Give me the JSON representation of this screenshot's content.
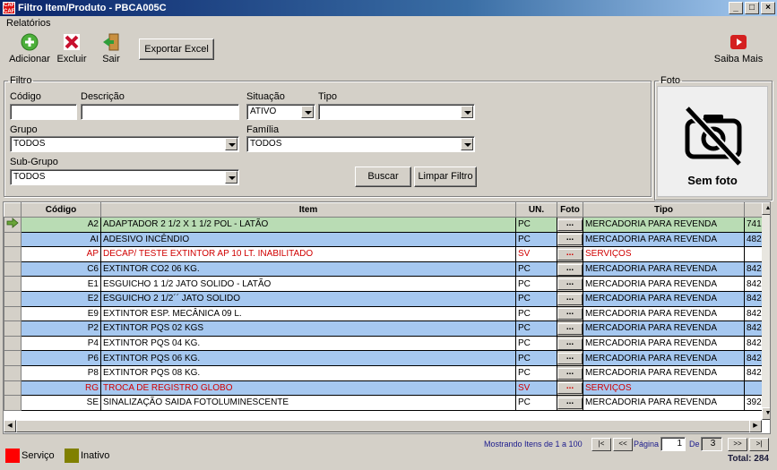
{
  "window": {
    "title": "Filtro Item/Produto - PBCA005C",
    "icon_text": "CAF CAF"
  },
  "menu": {
    "relatorios": "Relatórios"
  },
  "toolbar": {
    "adicionar": "Adicionar",
    "excluir": "Excluir",
    "sair": "Sair",
    "exportar_excel": "Exportar Excel",
    "saiba_mais": "Saiba Mais"
  },
  "filtro": {
    "legend": "Filtro",
    "codigo_label": "Código",
    "codigo_value": "",
    "descricao_label": "Descrição",
    "descricao_value": "",
    "situacao_label": "Situação",
    "situacao_value": "ATIVO",
    "tipo_label": "Tipo",
    "tipo_value": "",
    "grupo_label": "Grupo",
    "grupo_value": "TODOS",
    "familia_label": "Família",
    "familia_value": "TODOS",
    "subgrupo_label": "Sub-Grupo",
    "subgrupo_value": "TODOS",
    "buscar": "Buscar",
    "limpar_filtro": "Limpar Filtro"
  },
  "foto": {
    "legend": "Foto",
    "caption": "Sem foto"
  },
  "grid": {
    "columns": [
      "Código",
      "Item",
      "UN.",
      "Foto",
      "Tipo"
    ],
    "rows": [
      {
        "codigo": "A2",
        "item": "ADAPTADOR 2 1/2 X 1 1/2 POL - LATÃO",
        "un": "PC",
        "foto": "...",
        "tipo": "MERCADORIA PARA REVENDA",
        "extra": "741"
      },
      {
        "codigo": "AI",
        "item": "ADESIVO INCÊNDIO",
        "un": "PC",
        "foto": "...",
        "tipo": "MERCADORIA PARA REVENDA",
        "extra": "482"
      },
      {
        "codigo": "AP",
        "item": "DECAP/ TESTE EXTINTOR AP 10 LT. INABILITADO",
        "un": "SV",
        "foto": "...",
        "tipo": "SERVIÇOS",
        "extra": ""
      },
      {
        "codigo": "C6",
        "item": "EXTINTOR CO2 06 KG.",
        "un": "PC",
        "foto": "...",
        "tipo": "MERCADORIA PARA REVENDA",
        "extra": "842"
      },
      {
        "codigo": "E1",
        "item": "ESGUICHO 1 1/2 JATO SOLIDO - LATÃO",
        "un": "PC",
        "foto": "...",
        "tipo": "MERCADORIA PARA REVENDA",
        "extra": "842"
      },
      {
        "codigo": "E2",
        "item": "ESGUICHO 2 1/2´´ JATO SOLIDO",
        "un": "PC",
        "foto": "...",
        "tipo": "MERCADORIA PARA REVENDA",
        "extra": "842"
      },
      {
        "codigo": "E9",
        "item": "EXTINTOR ESP. MECÂNICA 09 L.",
        "un": "PC",
        "foto": "...",
        "tipo": "MERCADORIA PARA REVENDA",
        "extra": "842"
      },
      {
        "codigo": "P2",
        "item": "EXTINTOR PQS 02 KGS",
        "un": "PC",
        "foto": "...",
        "tipo": "MERCADORIA PARA REVENDA",
        "extra": "842"
      },
      {
        "codigo": "P4",
        "item": "EXTINTOR PQS 04 KG.",
        "un": "PC",
        "foto": "...",
        "tipo": "MERCADORIA PARA REVENDA",
        "extra": "842"
      },
      {
        "codigo": "P6",
        "item": "EXTINTOR PQS 06 KG.",
        "un": "PC",
        "foto": "...",
        "tipo": "MERCADORIA PARA REVENDA",
        "extra": "842"
      },
      {
        "codigo": "P8",
        "item": "EXTINTOR PQS 08 KG.",
        "un": "PC",
        "foto": "...",
        "tipo": "MERCADORIA PARA REVENDA",
        "extra": "842"
      },
      {
        "codigo": "RG",
        "item": "TROCA DE REGISTRO GLOBO",
        "un": "SV",
        "foto": "...",
        "tipo": "SERVIÇOS",
        "extra": ""
      },
      {
        "codigo": "SE",
        "item": "SINALIZAÇÃO SAIDA FOTOLUMINESCENTE",
        "un": "PC",
        "foto": "...",
        "tipo": "MERCADORIA PARA REVENDA",
        "extra": "392"
      }
    ]
  },
  "legend": {
    "servico": "Serviço",
    "inativo": "Inativo"
  },
  "colors": {
    "servico": "#ff0000",
    "inativo": "#808000",
    "selected_row": "#b9dcb4",
    "alt_row": "#a6c8f0",
    "service_text": "#d00000"
  },
  "pagination": {
    "mostrando": "Mostrando Itens de 1 a 100",
    "first": "|<",
    "prev": "<<",
    "pagina_label": "Página",
    "pagina_value": "1",
    "de_label": "De",
    "de_value": "3",
    "next": ">>",
    "last": ">|",
    "total": "Total: 284"
  }
}
